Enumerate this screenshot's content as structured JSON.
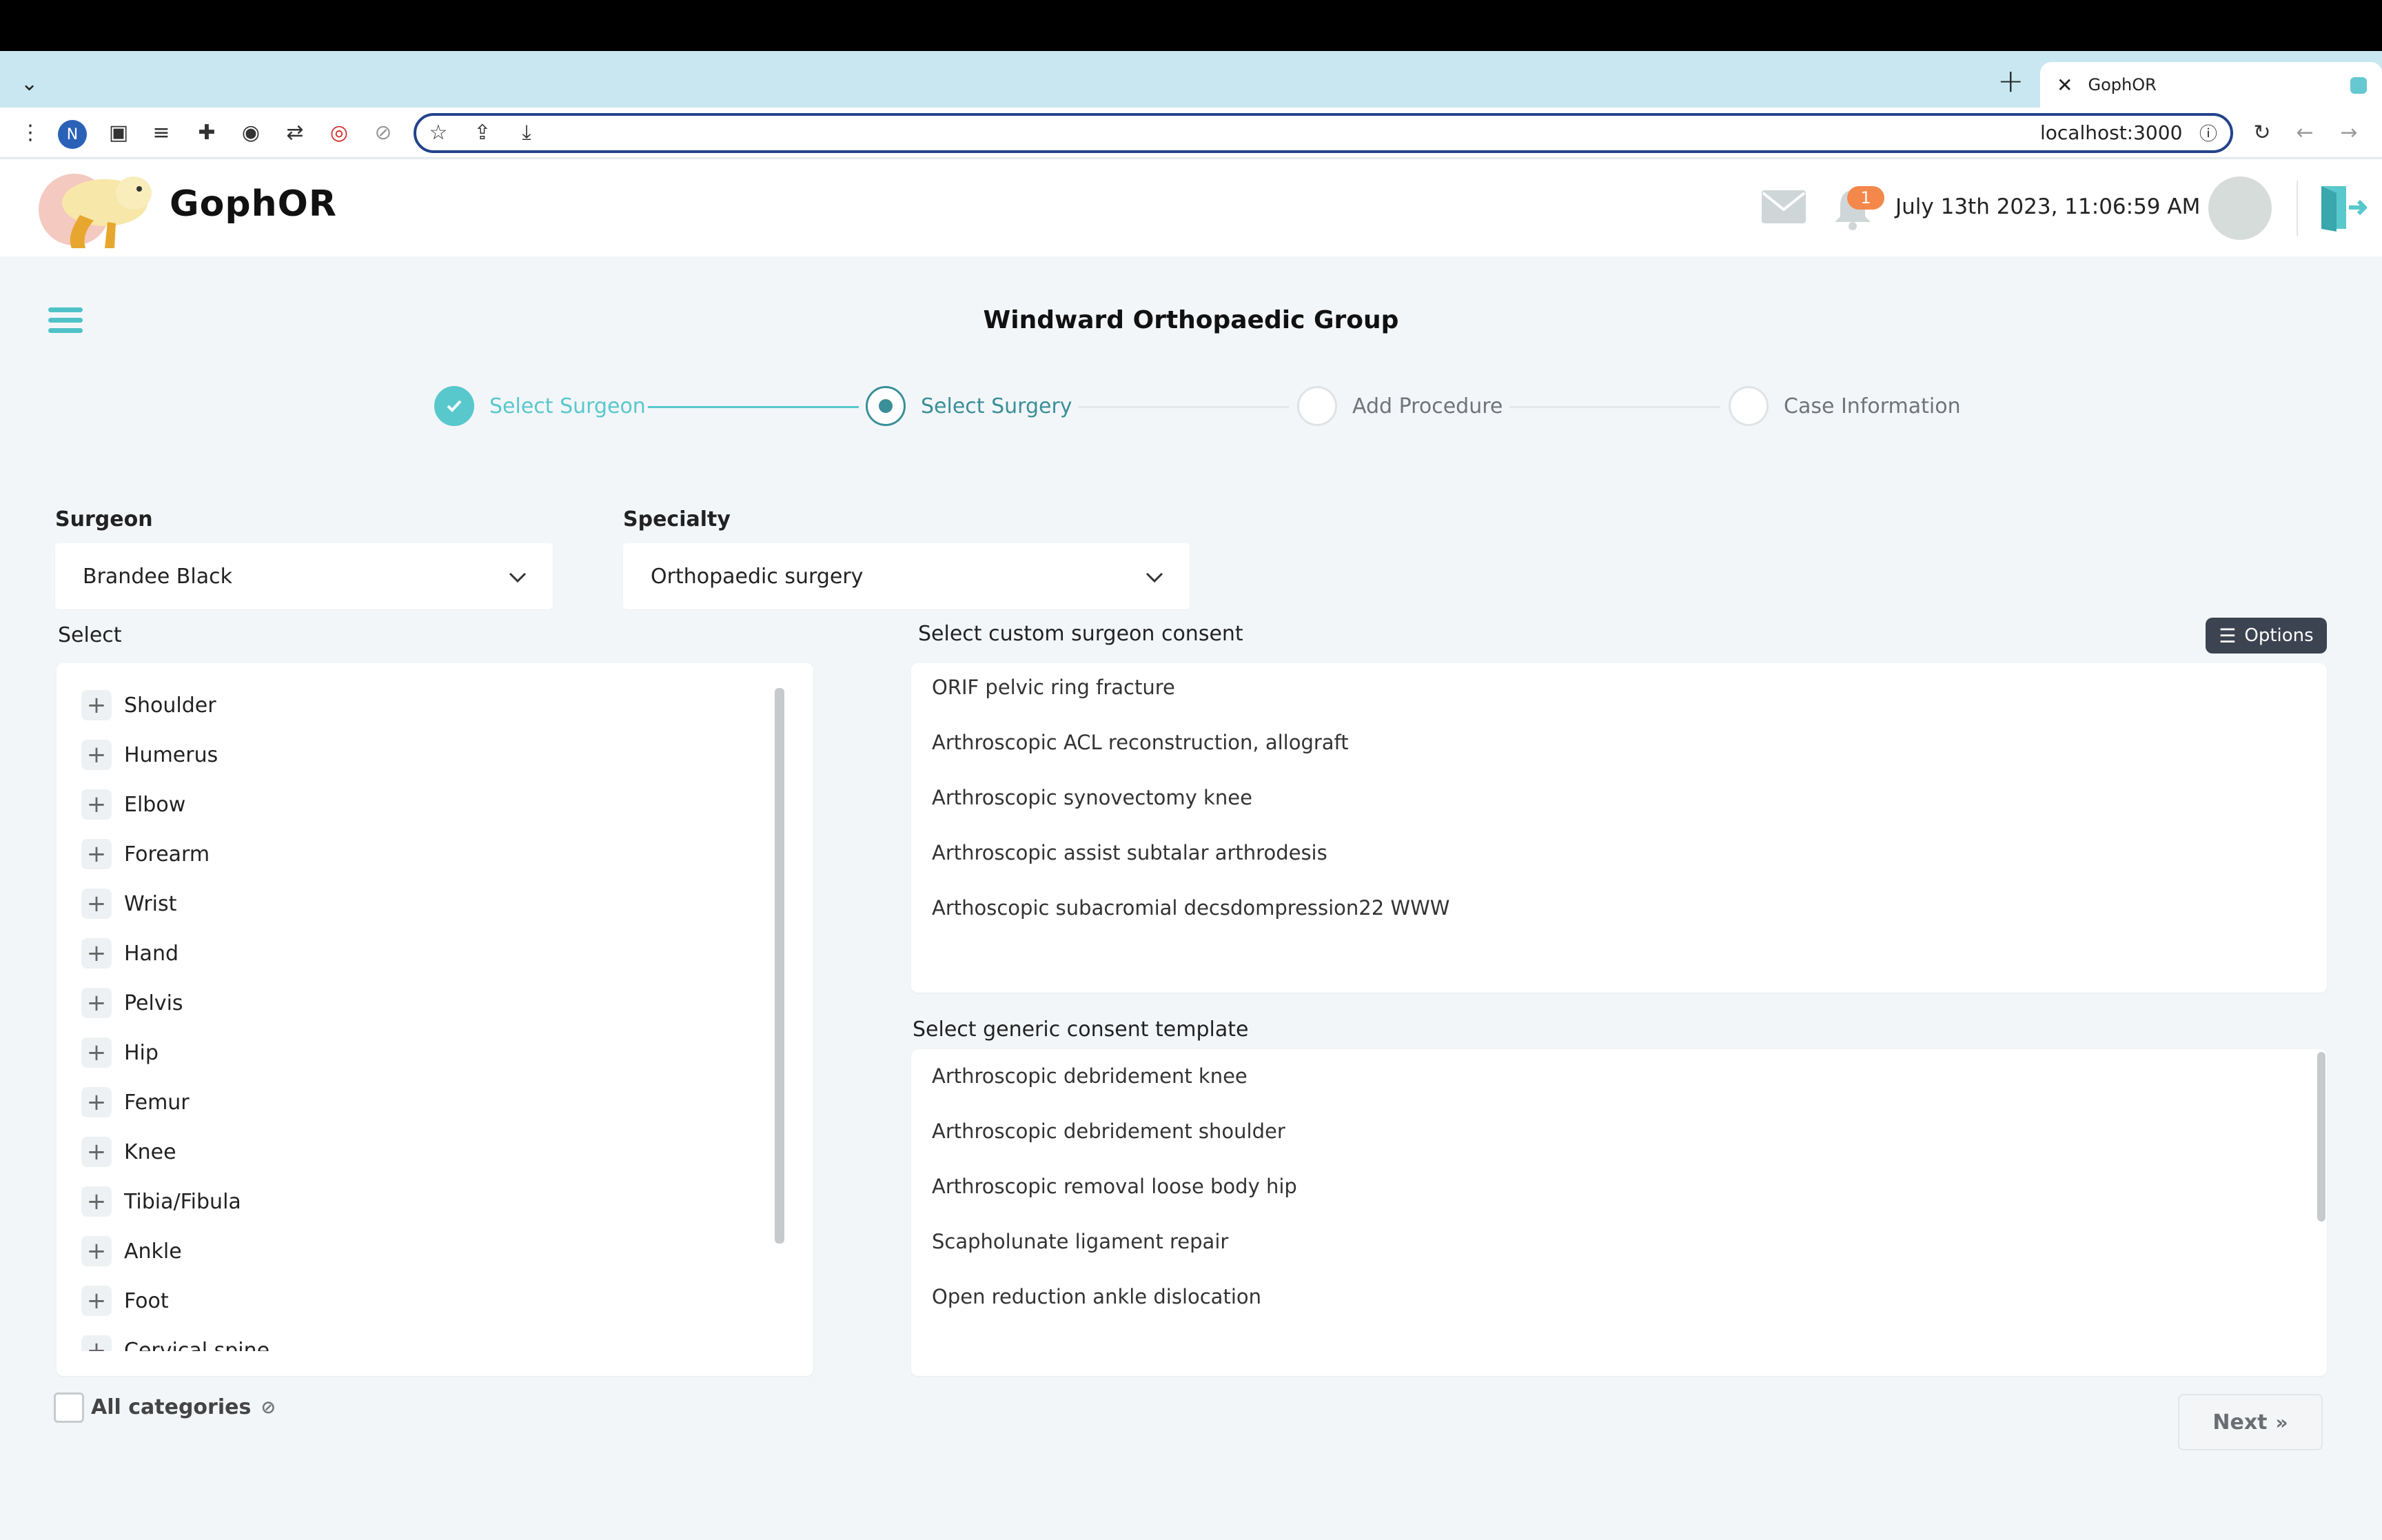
{
  "browser": {
    "tab_title": "GophOR",
    "url": "localhost:3000",
    "profile_initial": "N"
  },
  "header": {
    "brand": "GophOR",
    "notifications_count": "1",
    "datetime": "July 13th 2023, 11:06:59 AM"
  },
  "page": {
    "title": "Windward Orthopaedic Group"
  },
  "stepper": {
    "steps": [
      {
        "label": "Select Surgeon",
        "state": "done"
      },
      {
        "label": "Select Surgery",
        "state": "active"
      },
      {
        "label": "Add Procedure",
        "state": "pending"
      },
      {
        "label": "Case Information",
        "state": "pending"
      }
    ]
  },
  "form": {
    "surgeon_label": "Surgeon",
    "surgeon_value": "Brandee Black",
    "specialty_label": "Specialty",
    "specialty_value": "Orthopaedic surgery",
    "select_label": "Select",
    "custom_consent_label": "Select custom surgeon consent",
    "generic_consent_label": "Select generic consent template",
    "options_button": "Options",
    "all_categories": "All categories",
    "next_button": "Next"
  },
  "categories": [
    "Shoulder",
    "Humerus",
    "Elbow",
    "Forearm",
    "Wrist",
    "Hand",
    "Pelvis",
    "Hip",
    "Femur",
    "Knee",
    "Tibia/Fibula",
    "Ankle",
    "Foot",
    "Cervical spine"
  ],
  "custom_consents": [
    "ORIF pelvic ring fracture",
    "Arthroscopic ACL reconstruction, allograft",
    "Arthroscopic synovectomy knee",
    "Arthroscopic assist subtalar arthrodesis",
    "Arthoscopic subacromial decsdompression22 WWW"
  ],
  "generic_consents": [
    "Arthroscopic debridement knee",
    "Arthroscopic debridement shoulder",
    "Arthroscopic removal loose body hip",
    "Scapholunate ligament repair",
    "Open reduction ankle dislocation"
  ],
  "colors": {
    "accent": "#58c8cc",
    "active_step": "#3a8f98",
    "badge": "#f4874a",
    "options_button": "#3b4450"
  }
}
